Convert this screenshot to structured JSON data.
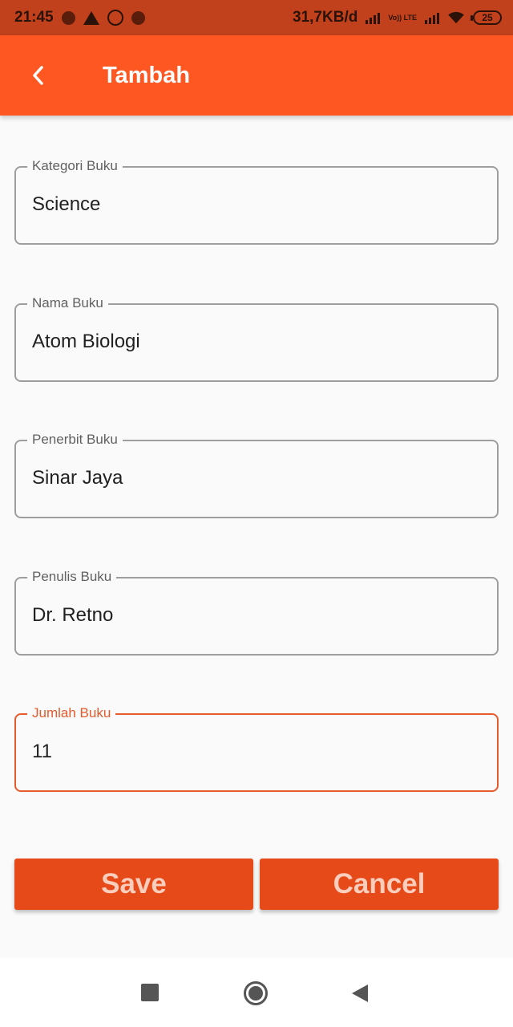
{
  "status_bar": {
    "time": "21:45",
    "network_speed": "31,7KB/d",
    "lte_label": "Vo)) LTE",
    "battery": "25"
  },
  "app_bar": {
    "title": "Tambah"
  },
  "form": {
    "fields": [
      {
        "label": "Kategori Buku",
        "value": "Science"
      },
      {
        "label": "Nama Buku",
        "value": "Atom Biologi"
      },
      {
        "label": "Penerbit Buku",
        "value": "Sinar Jaya"
      },
      {
        "label": "Penulis Buku",
        "value": "Dr. Retno"
      },
      {
        "label": "Jumlah Buku",
        "value": "11"
      }
    ],
    "save_label": "Save",
    "cancel_label": "Cancel"
  },
  "colors": {
    "primary": "#ff5722",
    "button": "#e64a19",
    "status_bar": "#c0411b",
    "focus": "#e65a2c"
  },
  "icons": {
    "back": "chevron-left-icon",
    "nav_recents": "square-icon",
    "nav_home": "circle-icon",
    "nav_back": "triangle-back-icon"
  }
}
